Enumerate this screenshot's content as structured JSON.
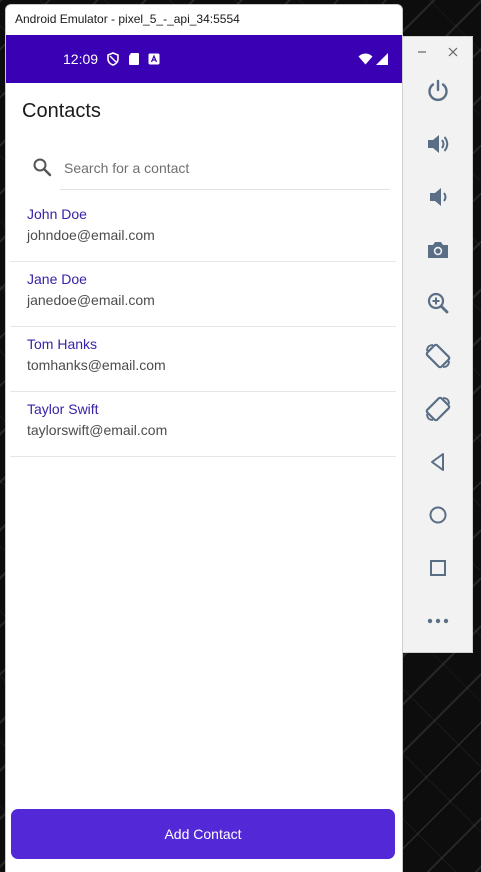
{
  "window": {
    "title": "Android Emulator - pixel_5_-_api_34:5554"
  },
  "status_bar": {
    "time": "12:09",
    "icons": [
      "shield-icon",
      "sd-card-icon",
      "keyboard-icon",
      "wifi-icon",
      "signal-icon"
    ]
  },
  "app": {
    "title": "Contacts",
    "search": {
      "placeholder": "Search for a contact",
      "value": ""
    },
    "contacts": [
      {
        "name": "John Doe",
        "email": "johndoe@email.com"
      },
      {
        "name": "Jane Doe",
        "email": "janedoe@email.com"
      },
      {
        "name": "Tom Hanks",
        "email": "tomhanks@email.com"
      },
      {
        "name": "Taylor Swift",
        "email": "taylorswift@email.com"
      }
    ],
    "add_button_label": "Add Contact"
  },
  "toolbar": {
    "buttons": [
      "minimize-icon",
      "close-icon",
      "power-icon",
      "volume-up-icon",
      "volume-down-icon",
      "camera-icon",
      "zoom-icon",
      "rotate-left-icon",
      "rotate-right-icon",
      "back-icon",
      "home-icon",
      "overview-icon",
      "more-icon"
    ]
  },
  "colors": {
    "status_bar": "#3a00b3",
    "accent": "#5328d6",
    "contact_name": "#3a21a8",
    "toolbar_icon": "#5a6f85"
  }
}
